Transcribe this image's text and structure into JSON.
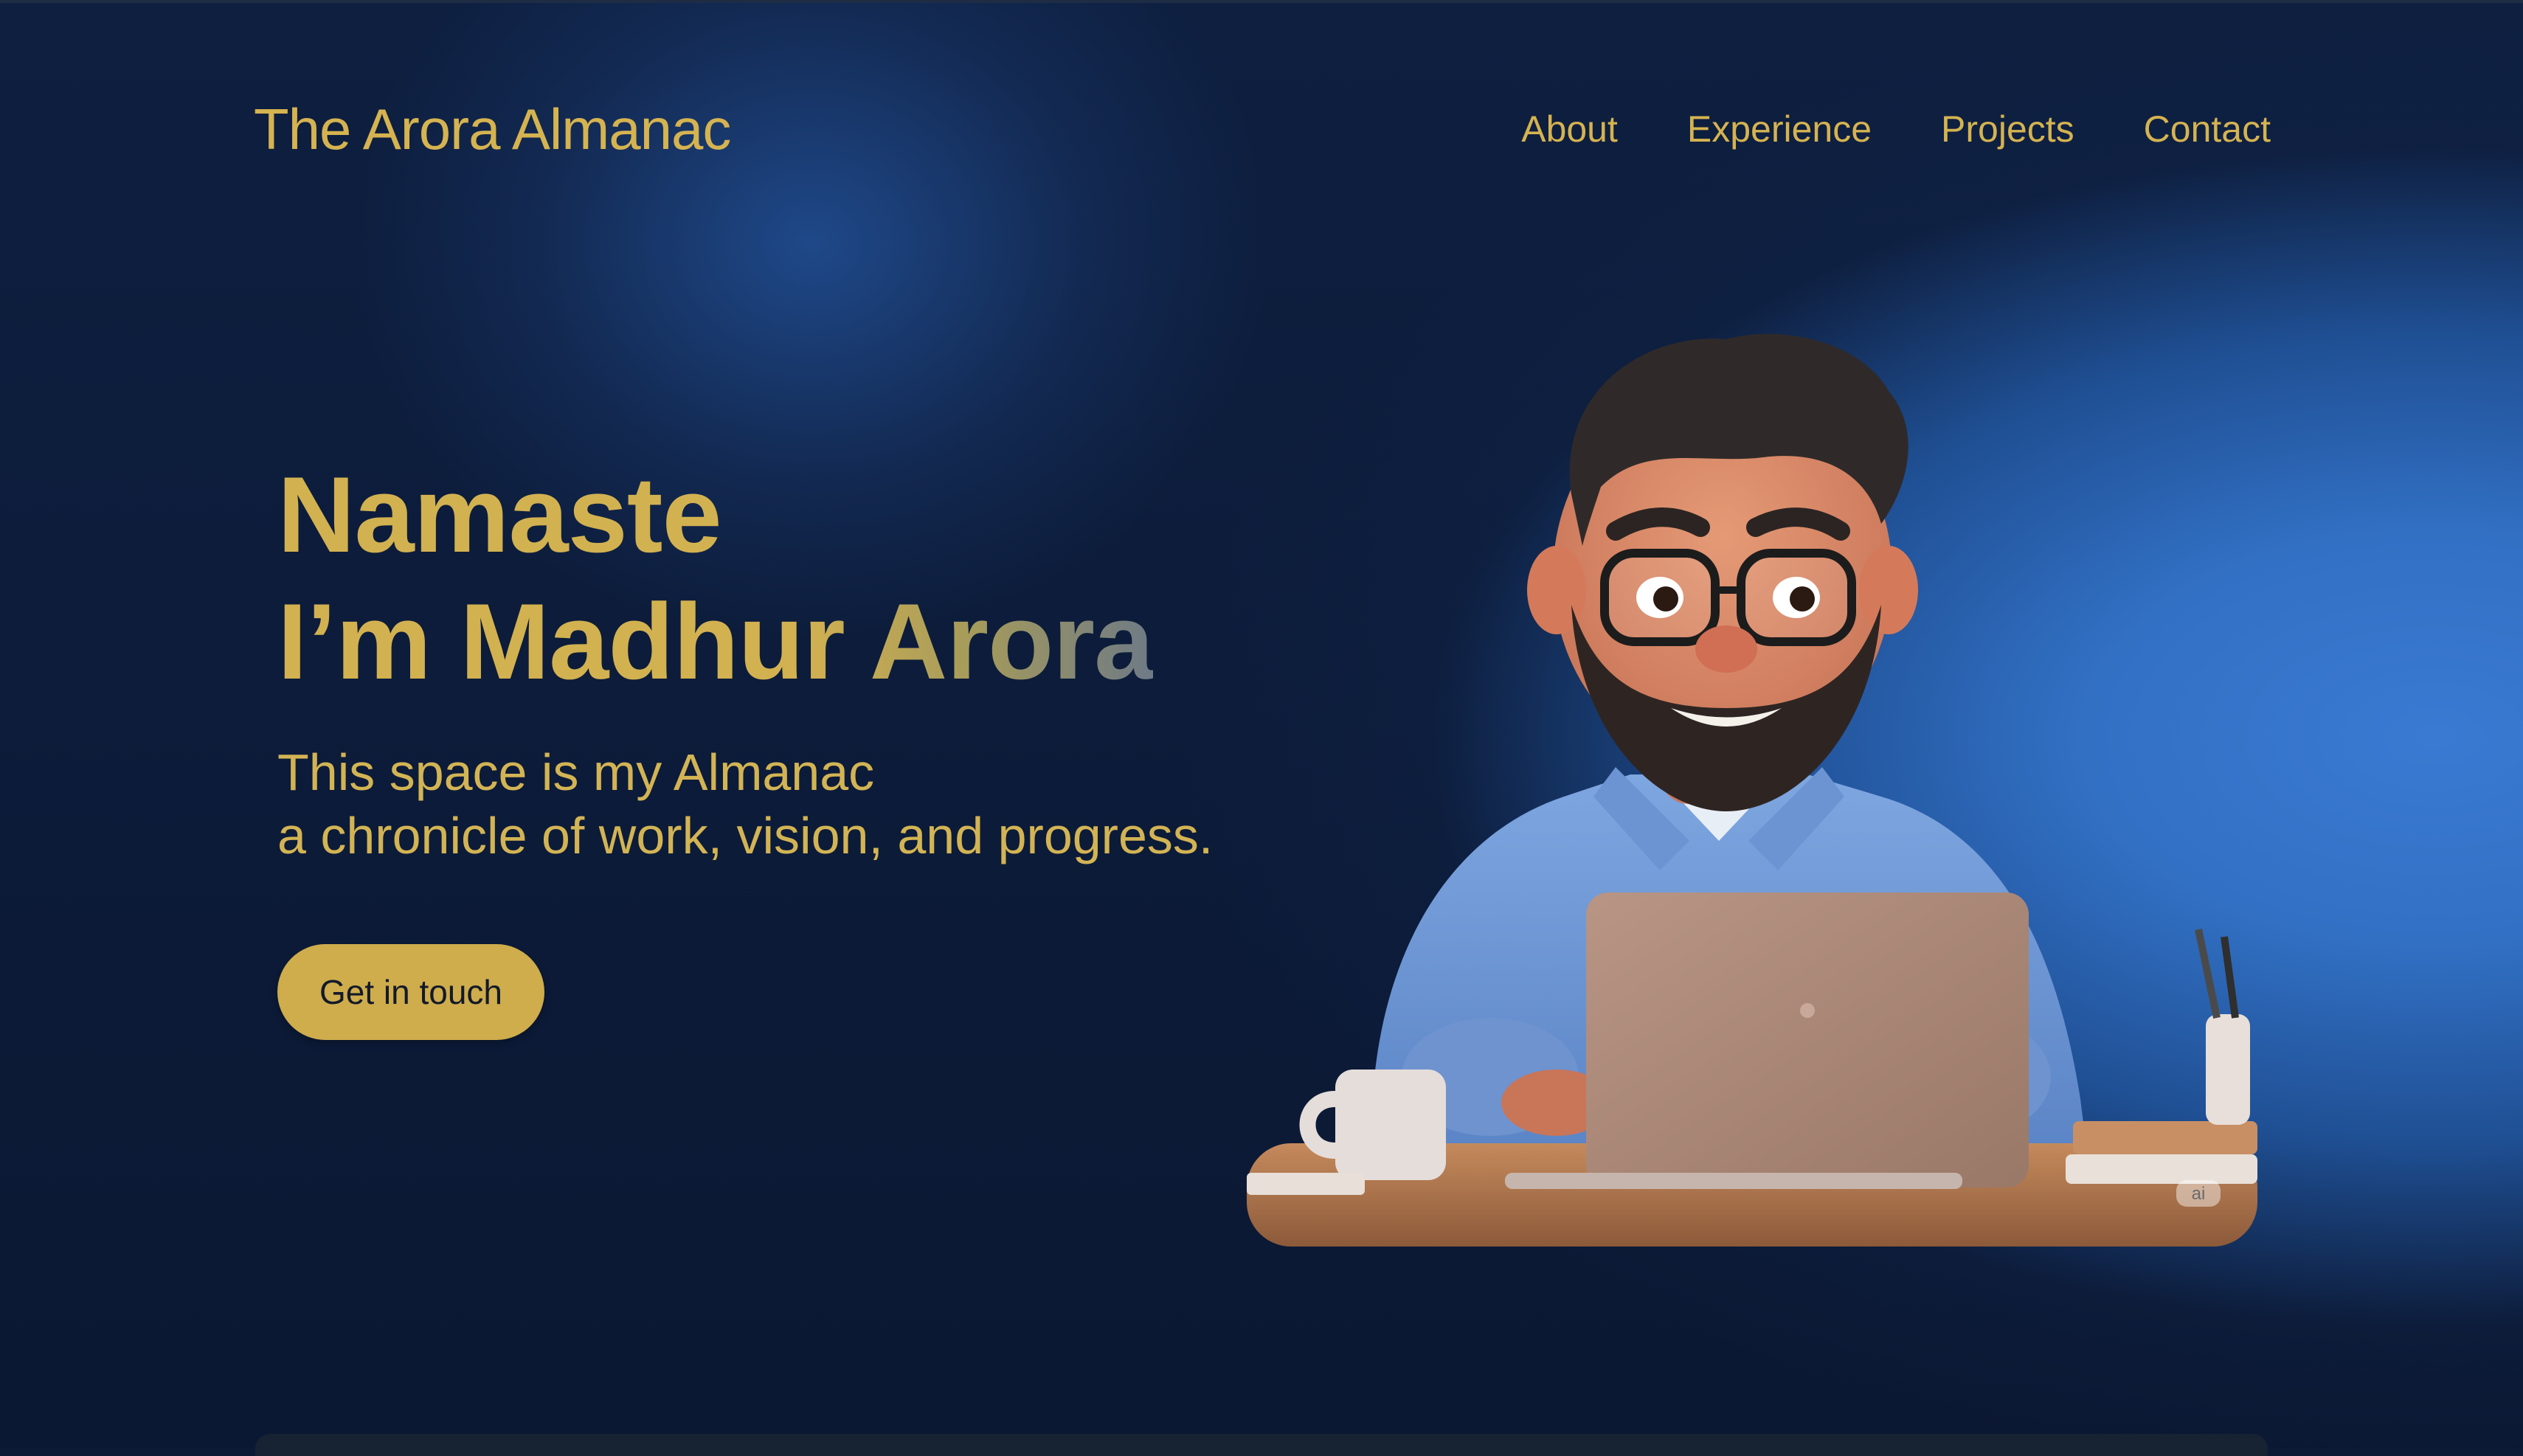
{
  "header": {
    "brand": "The Arora Almanac",
    "nav": [
      {
        "label": "About"
      },
      {
        "label": "Experience"
      },
      {
        "label": "Projects"
      },
      {
        "label": "Contact"
      }
    ]
  },
  "hero": {
    "greeting": "Namaste",
    "name_line": "I’m Madhur Arora",
    "subtitle_line1": "This space is my Almanac",
    "subtitle_line2": "a chronicle of work, vision, and progress.",
    "cta_label": "Get in touch",
    "illustration": {
      "icon": "developer-at-laptop-illustration",
      "badge": "ai"
    }
  },
  "colors": {
    "accent": "#d5b350",
    "background": "#0c1a36",
    "glow": "#3a7ad2"
  }
}
